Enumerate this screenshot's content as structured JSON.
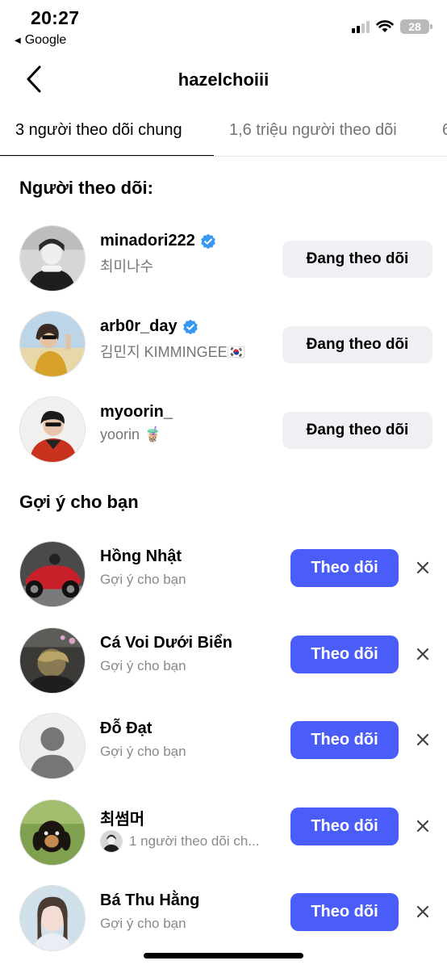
{
  "status": {
    "time": "20:27",
    "back_app": "Google",
    "battery": "28"
  },
  "header": {
    "title": "hazelchoiii"
  },
  "tabs": [
    {
      "label": "3 người theo dõi chung"
    },
    {
      "label": "1,6 triệu người theo dõi"
    },
    {
      "label": "6"
    }
  ],
  "followers": {
    "title": "Người theo dõi:",
    "items": [
      {
        "username": "minadori222",
        "name": "최미나수",
        "verified": true,
        "button": "Đang theo dõi"
      },
      {
        "username": "arb0r_day",
        "name": "김민지 KIMMINGEE🇰🇷",
        "verified": true,
        "button": "Đang theo dõi"
      },
      {
        "username": "myoorin_",
        "name": "yoorin 🧋",
        "verified": false,
        "button": "Đang theo dõi"
      }
    ]
  },
  "suggestions": {
    "title": "Gợi ý cho bạn",
    "items": [
      {
        "name": "Hồng Nhật",
        "sub": "Gợi ý cho bạn",
        "button": "Theo dõi"
      },
      {
        "name": "Cá Voi Dưới Biển",
        "sub": "Gợi ý cho bạn",
        "button": "Theo dõi"
      },
      {
        "name": "Đỗ Đạt",
        "sub": "Gợi ý cho bạn",
        "button": "Theo dõi"
      },
      {
        "name": "최썸머",
        "sub": "1 người theo dõi ch...",
        "button": "Theo dõi"
      },
      {
        "name": "Bá Thu Hằng",
        "sub": "Gợi ý cho bạn",
        "button": "Theo dõi"
      }
    ]
  },
  "colors": {
    "accent": "#4a5df9",
    "verified": "#3897f0",
    "secondary_text": "#757575",
    "button_bg": "#eff0f3"
  }
}
